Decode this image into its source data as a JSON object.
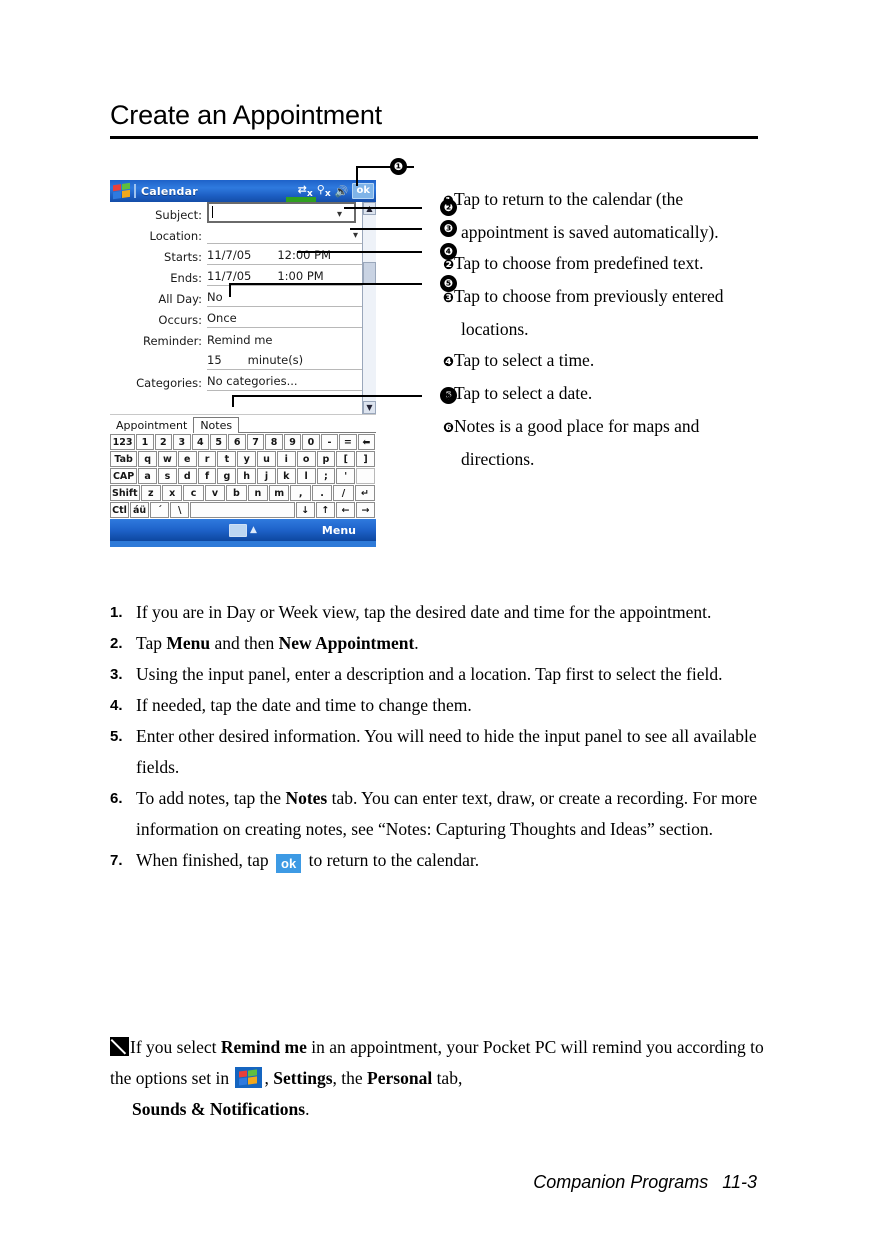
{
  "heading": "Create an Appointment",
  "pda": {
    "title": "Calendar",
    "status_icons": [
      "signal-x-icon",
      "connectivity-x-icon",
      "volume-icon"
    ],
    "ok_label": "ok",
    "fields": [
      {
        "label": "Subject:",
        "value": ""
      },
      {
        "label": "Location:",
        "value": ""
      },
      {
        "label": "Starts:",
        "value": "11/7/05",
        "value2": "12:00 PM"
      },
      {
        "label": "Ends:",
        "value": "11/7/05",
        "value2": "1:00 PM"
      },
      {
        "label": "All Day:",
        "value": "No"
      },
      {
        "label": "Occurs:",
        "value": "Once"
      },
      {
        "label": "Reminder:",
        "value": "Remind me"
      },
      {
        "label": "",
        "value": "15",
        "value2": "minute(s)"
      },
      {
        "label": "Categories:",
        "value": "No categories..."
      }
    ],
    "tabs": [
      {
        "label": "Appointment",
        "selected": false
      },
      {
        "label": "Notes",
        "selected": true
      }
    ],
    "keyboard": {
      "row1": [
        "123",
        "1",
        "2",
        "3",
        "4",
        "5",
        "6",
        "7",
        "8",
        "9",
        "0",
        "-",
        "=",
        "⬅"
      ],
      "row2": [
        "Tab",
        "q",
        "w",
        "e",
        "r",
        "t",
        "y",
        "u",
        "i",
        "o",
        "p",
        "[",
        "]"
      ],
      "row3": [
        "CAP",
        "a",
        "s",
        "d",
        "f",
        "g",
        "h",
        "j",
        "k",
        "l",
        ";",
        "'"
      ],
      "row4": [
        "Shift",
        "z",
        "x",
        "c",
        "v",
        "b",
        "n",
        "m",
        ",",
        ".",
        "/",
        "↵"
      ],
      "row5": [
        "Ctl",
        "áü",
        "´",
        "\\",
        "",
        "↓",
        "↑",
        "←",
        "→"
      ]
    },
    "taskbar": {
      "keyboard_icon": "input-panel-icon",
      "menu_label": "Menu"
    }
  },
  "callouts": [
    {
      "num": "❶"
    },
    {
      "num": "❷"
    },
    {
      "num": "❸"
    },
    {
      "num": "❹"
    },
    {
      "num": "❺"
    },
    {
      "num": "❻"
    }
  ],
  "descriptions": [
    {
      "num": "❶",
      "text": "Tap to return to the calendar (the appointment is saved automatically)."
    },
    {
      "num": "❷",
      "text": "Tap to choose from predefined text."
    },
    {
      "num": "❸",
      "text": "Tap to choose from previously entered locations."
    },
    {
      "num": "❹",
      "text": "Tap to select a time."
    },
    {
      "num": "❺",
      "text": "Tap to select a date."
    },
    {
      "num": "❻",
      "text": "Notes is a good place for maps and directions."
    }
  ],
  "procedure": [
    {
      "num": "1.",
      "pre": "If you are in Day or Week view, tap the desired date and time for the appointment.",
      "bold": "",
      "post": ""
    },
    {
      "num": "2.",
      "pre": "Tap ",
      "bold": "Menu",
      "mid": " and then ",
      "bold2": "New Appointment",
      "post": "."
    },
    {
      "num": "3.",
      "pre": "Using the input panel, enter a description and a location. Tap first to select the field.",
      "bold": "",
      "post": ""
    },
    {
      "num": "4.",
      "pre": "If needed, tap the date and time to change them.",
      "bold": "",
      "post": ""
    },
    {
      "num": "5.",
      "pre": "Enter other desired information. You will need to hide the input panel to see all available fields.",
      "bold": "",
      "post": ""
    },
    {
      "num": "6.",
      "pre": "To add notes, tap the ",
      "bold": "Notes",
      "post": " tab. You can enter text, draw, or create a recording. For more information on creating notes, see “Notes: Capturing Thoughts and Ideas” section."
    },
    {
      "num": "7.",
      "pre": "When finished, tap ",
      "ok_label": "ok",
      "post": " to return to the calendar."
    }
  ],
  "note": {
    "icon": "note-pencil-icon",
    "part1": "If you select ",
    "bold1": "Remind me",
    "part2": " in an appointment, your Pocket PC will remind you according to the options set in ",
    "icon2": "windows-start-icon",
    "part3": ", ",
    "bold2": "Settings",
    "part4": ", the ",
    "bold3": "Personal",
    "part5": " tab, ",
    "bold4": "Sounds & Notifications",
    "part6": "."
  },
  "footer": {
    "section": "Companion Programs",
    "page": "11-3"
  }
}
